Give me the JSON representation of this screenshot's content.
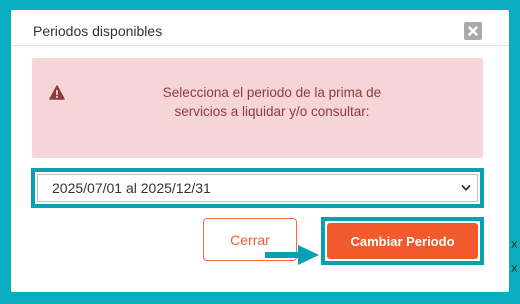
{
  "modal": {
    "title": "Periodos disponibles",
    "close_icon": "close-icon",
    "alert": {
      "icon": "warning-icon",
      "line1": "Selecciona el periodo de la prima de",
      "line2": "servicios a liquidar y/o consultar:",
      "background": "#f5d5d8",
      "text_color": "#8d3a3f"
    },
    "select": {
      "value": "2025/07/01 al 2025/12/31",
      "icon": "chevron-down-icon"
    },
    "buttons": {
      "cerrar_label": "Cerrar",
      "cambiar_label": "Cambiar Periodo"
    }
  },
  "colors": {
    "backdrop": "#0aaec0",
    "highlight": "#0a9fb3",
    "primary": "#f05a2d"
  },
  "side_marks": [
    "X",
    "X"
  ]
}
